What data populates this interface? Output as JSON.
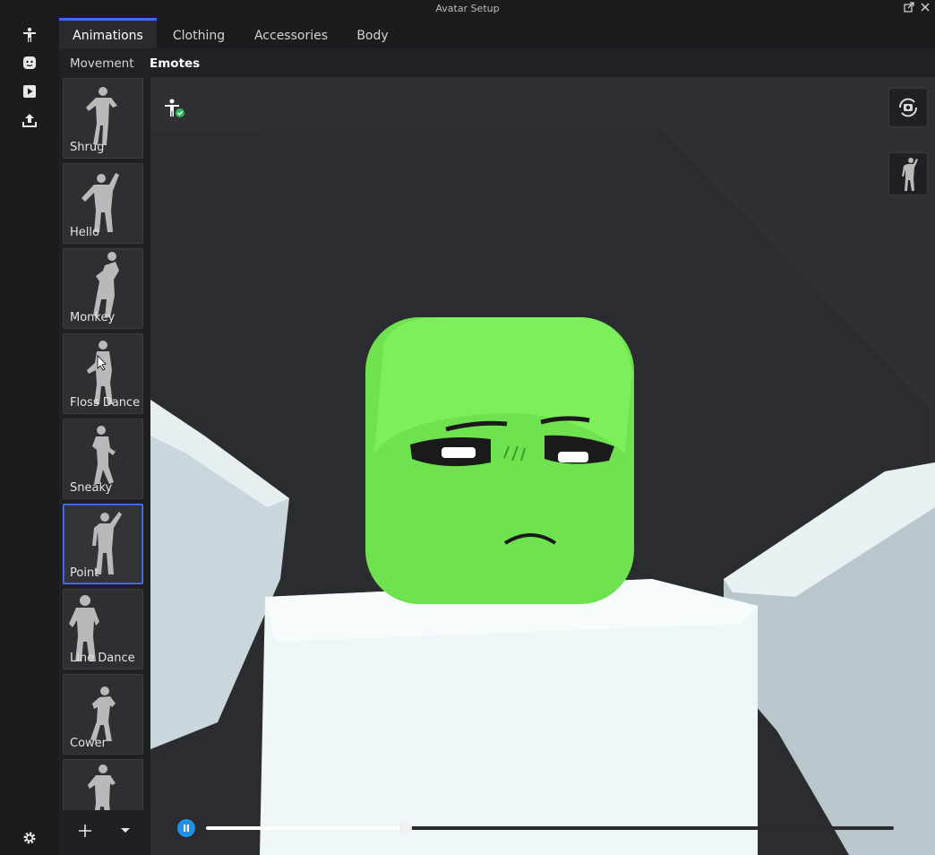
{
  "window": {
    "title": "Avatar Setup"
  },
  "tabs": [
    {
      "label": "Animations",
      "active": true
    },
    {
      "label": "Clothing",
      "active": false
    },
    {
      "label": "Accessories",
      "active": false
    },
    {
      "label": "Body",
      "active": false
    }
  ],
  "subtabs": [
    {
      "label": "Movement",
      "active": false
    },
    {
      "label": "Emotes",
      "active": true
    }
  ],
  "emotes": [
    {
      "label": "Shrug"
    },
    {
      "label": "Hello"
    },
    {
      "label": "Monkey"
    },
    {
      "label": "Floss Dance"
    },
    {
      "label": "Sneaky"
    },
    {
      "label": "Point",
      "selected": true
    },
    {
      "label": "Line Dance"
    },
    {
      "label": "Cower"
    },
    {
      "label": ""
    }
  ],
  "rail_icons": [
    "avatar-icon",
    "face-icon",
    "play-icon",
    "upload-icon",
    "settings-icon"
  ],
  "viewport": {
    "playback": {
      "state": "paused",
      "progress": 0.29
    },
    "colors": {
      "accent": "#3c6df0",
      "head": "#6fe24f",
      "body": "#eef6f8",
      "background": "#2f3033"
    }
  }
}
